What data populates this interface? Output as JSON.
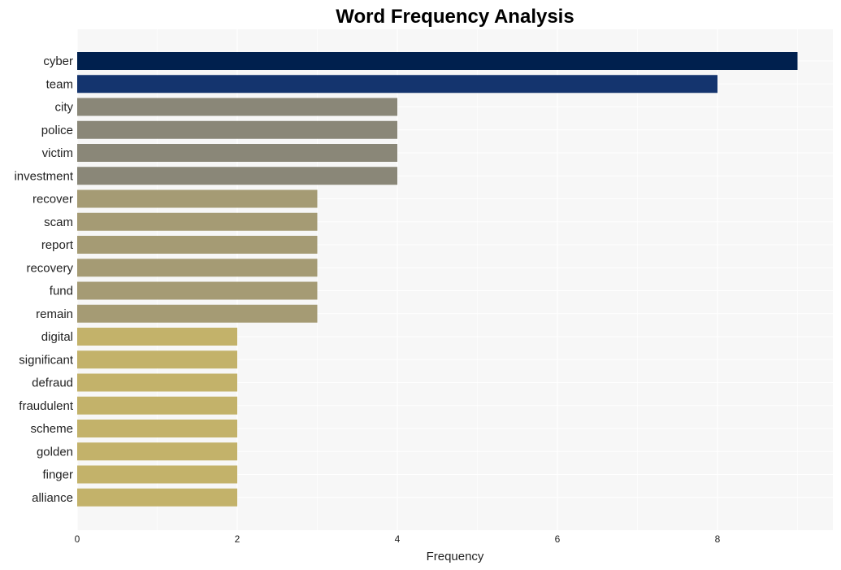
{
  "chart_data": {
    "type": "bar",
    "orientation": "horizontal",
    "title": "Word Frequency Analysis",
    "xlabel": "Frequency",
    "ylabel": "",
    "xlim": [
      0,
      9.45
    ],
    "xticks": [
      0,
      2,
      4,
      6,
      8
    ],
    "grid": true,
    "legend": "none",
    "categories": [
      "cyber",
      "team",
      "city",
      "police",
      "victim",
      "investment",
      "recover",
      "scam",
      "report",
      "recovery",
      "fund",
      "remain",
      "digital",
      "significant",
      "defraud",
      "fraudulent",
      "scheme",
      "golden",
      "finger",
      "alliance"
    ],
    "values": [
      9,
      8,
      4,
      4,
      4,
      4,
      3,
      3,
      3,
      3,
      3,
      3,
      2,
      2,
      2,
      2,
      2,
      2,
      2,
      2
    ],
    "colors": [
      "#00204e",
      "#14346e",
      "#8a8778",
      "#8a8778",
      "#8a8778",
      "#8a8778",
      "#a59b74",
      "#a59b74",
      "#a59b74",
      "#a59b74",
      "#a59b74",
      "#a59b74",
      "#c3b26a",
      "#c3b26a",
      "#c3b26a",
      "#c3b26a",
      "#c3b26a",
      "#c3b26a",
      "#c3b26a",
      "#c3b26a"
    ],
    "background": "#f7f7f7"
  }
}
